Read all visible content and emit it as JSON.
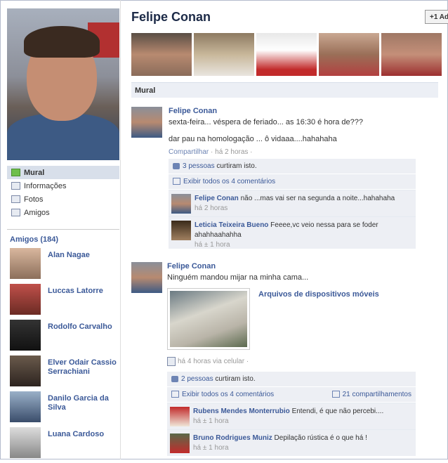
{
  "profile": {
    "name": "Felipe Conan",
    "add_button": "+1 Ad"
  },
  "nav": [
    {
      "label": "Mural",
      "icon": "wall-icon",
      "active": true
    },
    {
      "label": "Informações",
      "icon": "info-icon",
      "active": false
    },
    {
      "label": "Fotos",
      "icon": "photos-icon",
      "active": false
    },
    {
      "label": "Amigos",
      "icon": "friends-icon",
      "active": false
    }
  ],
  "friends": {
    "title": "Amigos (184)",
    "list": [
      {
        "name": "Alan Nagae"
      },
      {
        "name": "Luccas Latorre"
      },
      {
        "name": "Rodolfo Carvalho"
      },
      {
        "name": "Elver Odair Cassio Serrachiani"
      },
      {
        "name": "Danilo Garcia da Silva"
      },
      {
        "name": "Luana Cardoso"
      }
    ]
  },
  "section_title": "Mural",
  "post1": {
    "author": "Felipe Conan",
    "line1": "sexta-feira... véspera de feriado... as 16:30 é hora de???",
    "line2": "dar pau na homologação ... ô vidaaa....hahahaha",
    "share": "Compartilhar",
    "time": "· há 2 horas ·",
    "likes_link": "3 pessoas",
    "likes_text": " curtiram isto.",
    "view_comments": "Exibir todos os 4 comentários",
    "comments": [
      {
        "name": "Felipe Conan",
        "text": " não ...mas vai ser na segunda a noite...hahahaha",
        "time": "há 2 horas"
      },
      {
        "name": "Leticia Teixeira Bueno",
        "text": " Feeee,vc veio nessa para se foder ahahhaahahha",
        "time": "há ± 1 hora"
      }
    ]
  },
  "post2": {
    "author": "Felipe Conan",
    "text": "Ninguém mandou mijar na minha cama...",
    "attachment_title": "Arquivos de dispositivos móveis",
    "time": "há 4 horas via celular ·",
    "likes_link": "2 pessoas",
    "likes_text": " curtiram isto.",
    "view_comments": "Exibir todos os 4 comentários",
    "shares": "21 compartilhamentos",
    "comments": [
      {
        "name": "Rubens Mendes Monterrubio",
        "text": " Entendi, é que não percebi....",
        "time": "há ± 1 hora"
      },
      {
        "name": "Bruno Rodrigues Muniz",
        "text": " Depilação rústica é o que há !",
        "time": "há ± 1 hora"
      }
    ]
  },
  "colors": {
    "link": "#3b5998",
    "ufi_bg": "#edeff4",
    "nav_active": "#d8dfea"
  }
}
